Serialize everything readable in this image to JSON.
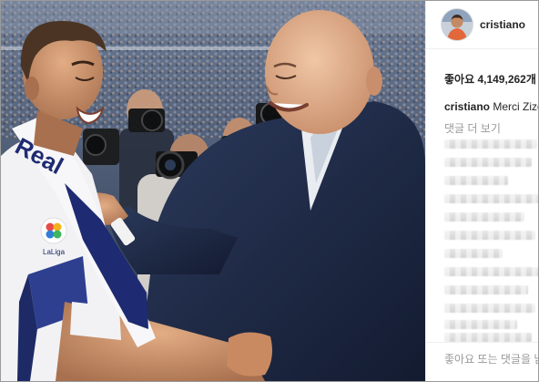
{
  "post": {
    "username": "cristiano",
    "likes_text": "좋아요 4,149,262개",
    "caption_user": "cristiano",
    "caption_text": " Merci Zizou",
    "more_comments": "댓글 더 보기",
    "comment_placeholder": "좋아요 또는 댓글을 남기세요"
  },
  "photo": {
    "scarf_text": "Real",
    "patch_text": "LaLiga"
  },
  "colors": {
    "crowd": "#44536b",
    "suit": "#1f2a44",
    "jersey": "#f2f2f4",
    "stripe": "#2e3f8f",
    "muted_text": "#999999"
  },
  "blurred_comment_rows": 12
}
